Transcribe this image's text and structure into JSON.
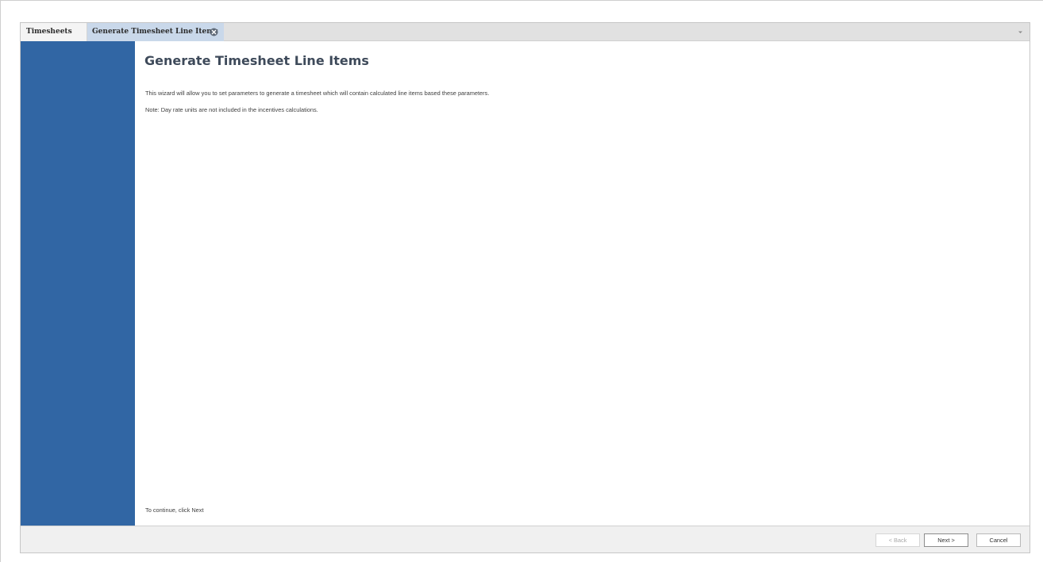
{
  "tabs": [
    {
      "label": "Timesheets",
      "active": false
    },
    {
      "label": "Generate Timesheet Line Items",
      "active": true,
      "closable": true
    }
  ],
  "wizard": {
    "title": "Generate Timesheet Line Items",
    "description": "This wizard will allow you to set parameters to generate a timesheet which will contain calculated line items based these parameters.",
    "note": "Note:  Day rate units are not included in the incentives calculations.",
    "continue_hint": "To continue, click Next"
  },
  "buttons": {
    "back": "< Back",
    "next": "Next >",
    "cancel": "Cancel"
  },
  "colors": {
    "sidebar": "#3166a4",
    "active_tab": "#c9d8ea",
    "title": "#3e4a5a"
  },
  "icons": {
    "tab_close": "close-circle-icon",
    "tab_menu": "chevron-down-icon"
  }
}
